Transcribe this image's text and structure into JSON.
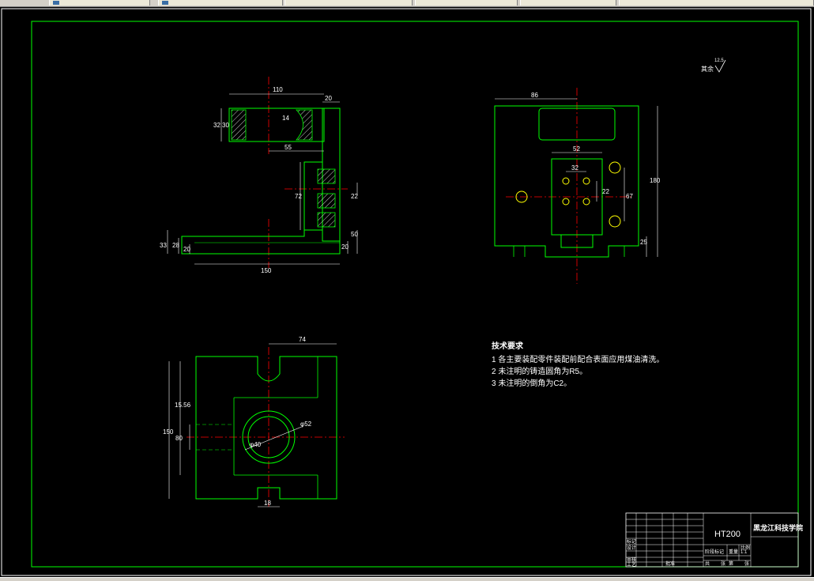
{
  "window": {
    "tabs": [
      {
        "label": ""
      },
      {
        "label": ""
      },
      {
        "label": ""
      },
      {
        "label": ""
      },
      {
        "label": ""
      },
      {
        "label": ""
      }
    ]
  },
  "drawing": {
    "roughness_other": "其余",
    "roughness_value": "12.5",
    "front_view": {
      "dims": [
        "110",
        "20",
        "32",
        "30",
        "14",
        "55",
        "72",
        "22",
        "50",
        "33",
        "28",
        "20",
        "20",
        "150"
      ]
    },
    "side_view": {
      "dims": [
        "86",
        "52",
        "32",
        "22",
        "67",
        "180",
        "25"
      ]
    },
    "top_view": {
      "dims": [
        "74",
        "15.56",
        "150",
        "80",
        "φ52",
        "φ40",
        "18"
      ]
    },
    "tech_requirements": {
      "title": "技术要求",
      "items": [
        "1  各主要装配零件装配前配合表面应用煤油清洗。",
        "2  未注明的铸造圆角为R5。",
        "3  未注明的倒角为C2。"
      ]
    },
    "title_block": {
      "material": "HT200",
      "school": "黑龙江科技学院",
      "scale": "1:1",
      "row_labels": [
        "标记",
        "设计",
        "审核",
        "工艺"
      ],
      "small_labels": [
        "阶段标记",
        "重量",
        "比例",
        "共",
        "张",
        "第",
        "张",
        "批准"
      ]
    }
  },
  "colors": {
    "background": "#000000",
    "outline": "#00ff00",
    "centerline": "#ff0000",
    "dimension": "#ffffff",
    "hatch": "#ffffff",
    "hole": "#ffff00"
  }
}
